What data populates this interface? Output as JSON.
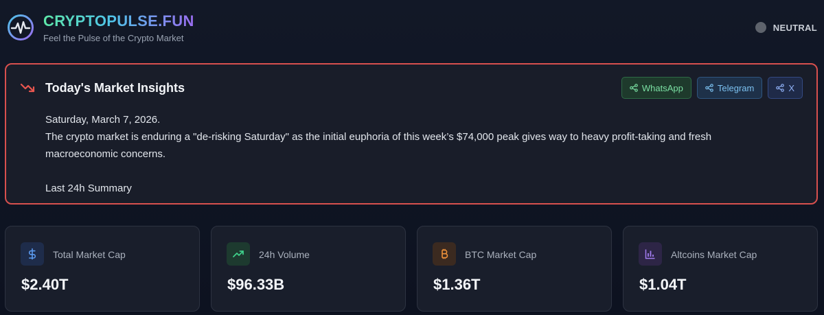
{
  "brand": {
    "title": "CRYPTOPULSE.FUN",
    "tagline": "Feel the Pulse of the Crypto Market",
    "icon": "pulse-logo-icon"
  },
  "sentiment": {
    "label": "NEUTRAL",
    "dot_color": "#5e636c"
  },
  "insights": {
    "title": "Today's Market Insights",
    "trend_icon": "trending-down-icon",
    "border_color": "#d8504e",
    "date": "Saturday, March 7, 2026.",
    "paragraph": "The crypto market is enduring a \"de-risking Saturday\" as the initial euphoria of this week’s $74,000 peak gives way to heavy profit-taking and fresh macroeconomic concerns.",
    "summary_heading": "Last 24h Summary",
    "share_buttons": [
      {
        "label": "WhatsApp",
        "icon": "share-icon",
        "color": "#7be0a3"
      },
      {
        "label": "Telegram",
        "icon": "share-icon",
        "color": "#7cc1f0"
      },
      {
        "label": "X",
        "icon": "share-icon",
        "color": "#8fb0f5"
      }
    ]
  },
  "stats": [
    {
      "label": "Total Market Cap",
      "value": "$2.40T",
      "icon": "dollar-icon",
      "color": "#5b9bf0"
    },
    {
      "label": "24h Volume",
      "value": "$96.33B",
      "icon": "trending-up-icon",
      "color": "#3fd08a"
    },
    {
      "label": "BTC Market Cap",
      "value": "$1.36T",
      "icon": "bitcoin-icon",
      "color": "#f0923a"
    },
    {
      "label": "Altcoins Market Cap",
      "value": "$1.04T",
      "icon": "bar-chart-icon",
      "color": "#a27cf0"
    }
  ]
}
